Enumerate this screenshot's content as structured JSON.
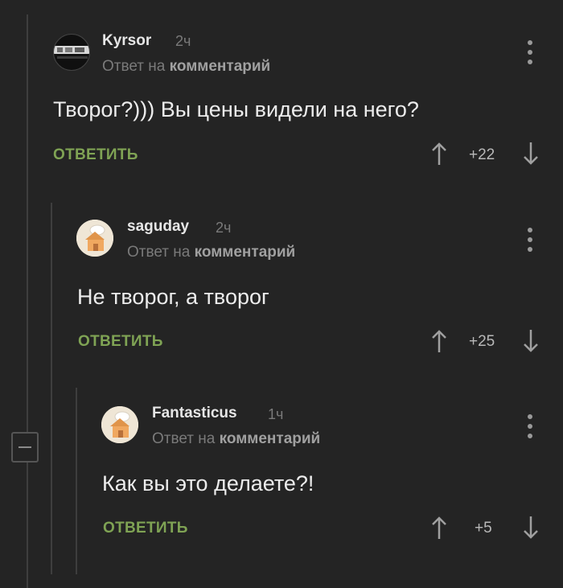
{
  "comments": [
    {
      "username": "Kyrsor",
      "time": "2ч",
      "reply_prefix": "Ответ на",
      "reply_target": "комментарий",
      "text": "Творог?))) Вы цены видели на него?",
      "reply_button": "ОТВЕТИТЬ",
      "score": "+22",
      "avatar": "logo-avatar"
    },
    {
      "username": "saguday",
      "time": "2ч",
      "reply_prefix": "Ответ на",
      "reply_target": "комментарий",
      "text": "Не творог, а творог",
      "reply_button": "ОТВЕТИТЬ",
      "score": "+25",
      "avatar": "house-avatar"
    },
    {
      "username": "Fantasticus",
      "time": "1ч",
      "reply_prefix": "Ответ на",
      "reply_target": "комментарий",
      "text": "Как вы это делаете?!",
      "reply_button": "ОТВЕТИТЬ",
      "score": "+5",
      "avatar": "house-avatar"
    }
  ],
  "colors": {
    "background": "#242424",
    "reply_button": "#7fa354",
    "thread_line": "#3e3e3e"
  },
  "icons": [
    "menu-dots-icon",
    "arrow-up-icon",
    "arrow-down-icon",
    "collapse-minus-icon"
  ]
}
